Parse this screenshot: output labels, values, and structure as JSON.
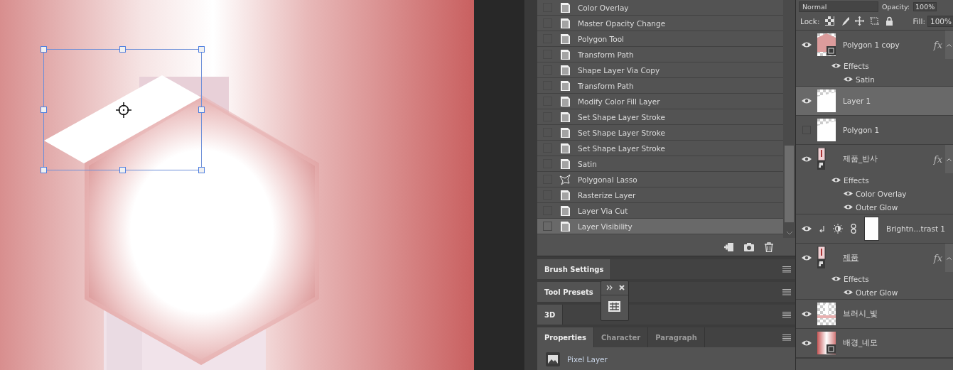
{
  "history": {
    "items": [
      {
        "label": "Color Overlay",
        "kind": "document",
        "selected": false
      },
      {
        "label": "Master Opacity Change",
        "kind": "document",
        "selected": false
      },
      {
        "label": "Polygon Tool",
        "kind": "document",
        "selected": false
      },
      {
        "label": "Transform Path",
        "kind": "document",
        "selected": false
      },
      {
        "label": "Shape Layer Via Copy",
        "kind": "document",
        "selected": false
      },
      {
        "label": "Transform Path",
        "kind": "document",
        "selected": false
      },
      {
        "label": "Modify Color Fill Layer",
        "kind": "document",
        "selected": false
      },
      {
        "label": "Set Shape Layer Stroke",
        "kind": "document",
        "selected": false
      },
      {
        "label": "Set Shape Layer Stroke",
        "kind": "document",
        "selected": false
      },
      {
        "label": "Set Shape Layer Stroke",
        "kind": "document",
        "selected": false
      },
      {
        "label": "Satin",
        "kind": "document",
        "selected": false
      },
      {
        "label": "Polygonal Lasso",
        "kind": "lasso",
        "selected": false
      },
      {
        "label": "Rasterize Layer",
        "kind": "document",
        "selected": false
      },
      {
        "label": "Layer Via Cut",
        "kind": "document",
        "selected": false
      },
      {
        "label": "Layer Visibility",
        "kind": "document",
        "selected": true
      }
    ]
  },
  "panel_groups": [
    {
      "tabs": [
        {
          "label": "Brush Settings",
          "selected": true
        }
      ]
    },
    {
      "tabs": [
        {
          "label": "Tool Presets",
          "selected": true
        }
      ]
    },
    {
      "tabs": [
        {
          "label": "3D",
          "selected": true
        }
      ]
    },
    {
      "tabs": [
        {
          "label": "Properties",
          "selected": true
        },
        {
          "label": "Character",
          "selected": false
        },
        {
          "label": "Paragraph",
          "selected": false
        }
      ],
      "content": "Pixel Layer"
    }
  ],
  "layers_panel": {
    "blend_mode": "Normal",
    "opacity_label": "Opacity:",
    "opacity": "100%",
    "lock_label": "Lock:",
    "fill_label": "Fill:",
    "fill": "100%",
    "layers": [
      {
        "name": "Polygon 1 copy",
        "kind": "layer",
        "thumbnail": {
          "kind": "shape"
        },
        "visible": true,
        "selected": false,
        "fx": "fx",
        "children": [
          {
            "name": "Effects",
            "children": [
              {
                "name": "Satin"
              }
            ]
          }
        ]
      },
      {
        "name": "Layer 1",
        "kind": "layer",
        "thumbnail": {
          "kind": "pixel"
        },
        "visible": true,
        "selected": true
      },
      {
        "name": "Polygon 1",
        "kind": "layer",
        "thumbnail": {
          "kind": "pixel"
        },
        "visible": false,
        "selected": false
      },
      {
        "name": "제품_반사",
        "kind": "layer",
        "thumbnail": {
          "kind": "smart"
        },
        "visible": true,
        "selected": false,
        "fx": "fx",
        "children": [
          {
            "name": "Effects",
            "children": [
              {
                "name": "Color Overlay"
              },
              {
                "name": "Outer Glow"
              }
            ]
          }
        ]
      },
      {
        "name": "Brightn...trast 1",
        "kind": "adjustment",
        "visible": true,
        "selected": false
      },
      {
        "name": "제품",
        "kind": "layer",
        "thumbnail": {
          "kind": "smart"
        },
        "visible": true,
        "selected": false,
        "underlined": true,
        "fx": "fx",
        "children": [
          {
            "name": "Effects",
            "children": [
              {
                "name": "Outer Glow"
              }
            ]
          }
        ]
      },
      {
        "name": "브러시_빛",
        "kind": "layer",
        "thumbnail": {
          "kind": "brush"
        },
        "visible": true,
        "selected": false
      },
      {
        "name": "배경_네모",
        "kind": "layer",
        "thumbnail": {
          "kind": "gradient"
        },
        "visible": true,
        "selected": false
      }
    ]
  }
}
